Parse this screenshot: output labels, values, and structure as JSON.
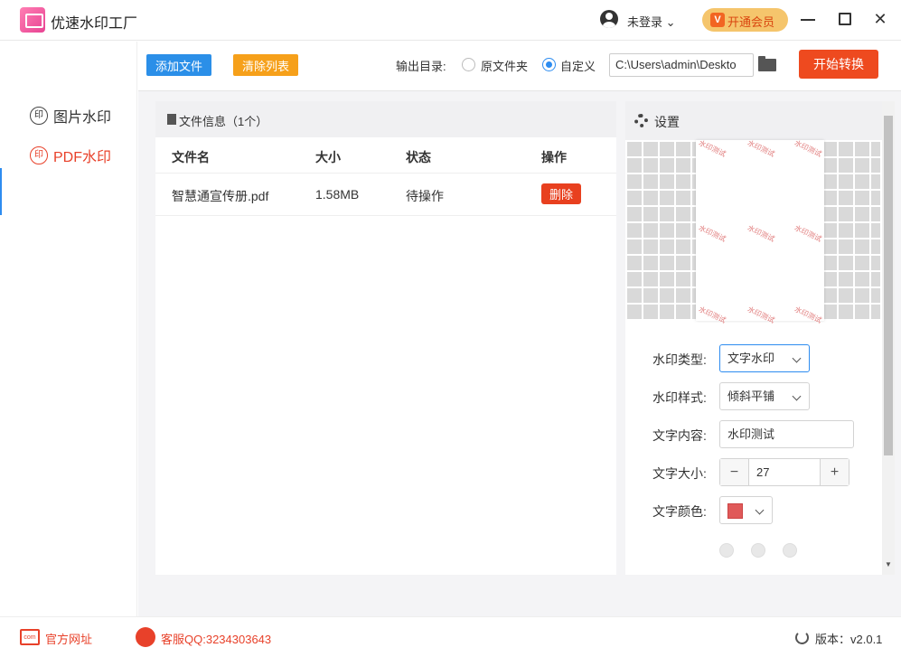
{
  "app": {
    "title": "优速水印工厂"
  },
  "header": {
    "login": "未登录",
    "vip": "开通会员",
    "close": "✕"
  },
  "sidebar": {
    "items": [
      {
        "label": "图片水印",
        "icon_char": "印"
      },
      {
        "label": "PDF水印",
        "icon_char": "印"
      }
    ]
  },
  "toolbar": {
    "add_label": "添加文件",
    "clear_label": "清除列表",
    "output_label": "输出目录:",
    "option_original": "原文件夹",
    "option_custom": "自定义",
    "path_value": "C:\\Users\\admin\\Deskto",
    "start_label": "开始转换"
  },
  "files": {
    "title": "文件信息（1个）",
    "columns": [
      "文件名",
      "大小",
      "状态",
      "操作"
    ],
    "rows": [
      {
        "name": "智慧通宣传册.pdf",
        "size": "1.58MB",
        "status": "待操作",
        "action": "删除"
      }
    ]
  },
  "settings": {
    "title": "设置",
    "watermark_text_preview": "水印测试",
    "type_label": "水印类型:",
    "type_value": "文字水印",
    "style_label": "水印样式:",
    "style_value": "倾斜平铺",
    "content_label": "文字内容:",
    "content_value": "水印测试",
    "size_label": "文字大小:",
    "size_value": "27",
    "color_label": "文字颜色:",
    "minus": "−",
    "plus": "+",
    "swatch_color": "#e05a5a"
  },
  "footer": {
    "web_icon": "com",
    "website": "官方网址",
    "qq": "客服QQ:3234303643",
    "version": "版本：v2.0.1"
  }
}
